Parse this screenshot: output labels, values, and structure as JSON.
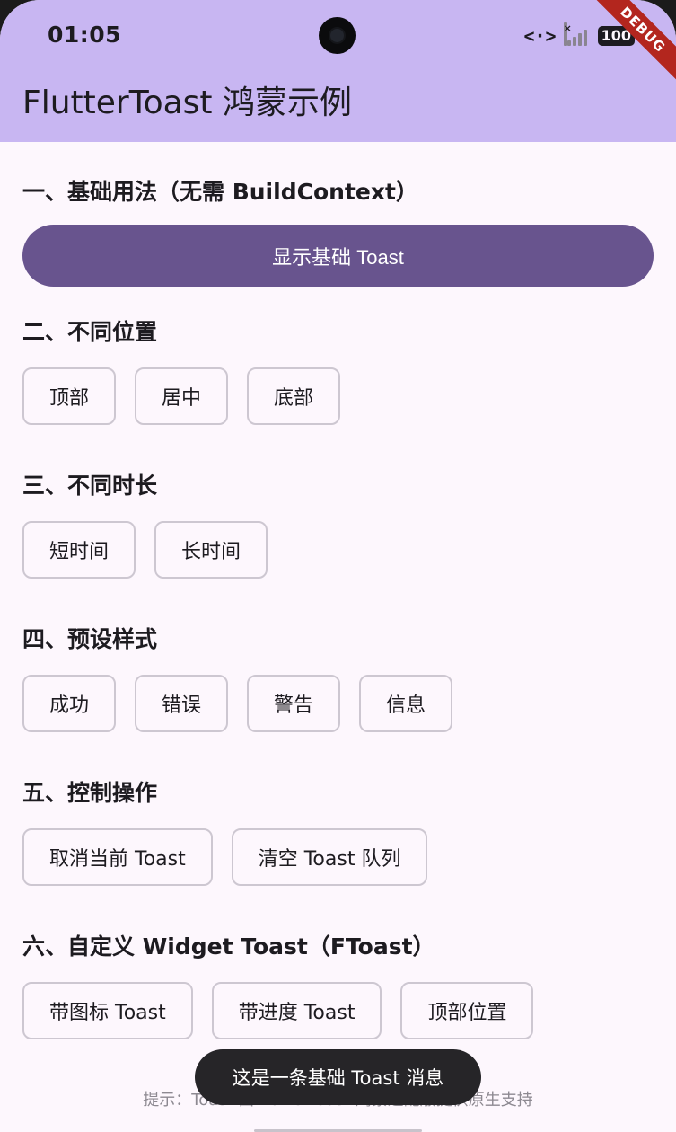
{
  "status_bar": {
    "time": "01:05",
    "code_icon": "<·>",
    "signal_x": "×",
    "battery": "100"
  },
  "debug_banner": "DEBUG",
  "app_title": "FlutterToast 鸿蒙示例",
  "sections": {
    "basic": {
      "title": "一、基础用法（无需 BuildContext）",
      "button": "显示基础 Toast"
    },
    "position": {
      "title": "二、不同位置",
      "buttons": [
        "顶部",
        "居中",
        "底部"
      ]
    },
    "duration": {
      "title": "三、不同时长",
      "buttons": [
        "短时间",
        "长时间"
      ]
    },
    "presets": {
      "title": "四、预设样式",
      "buttons": [
        "成功",
        "错误",
        "警告",
        "信息"
      ]
    },
    "control": {
      "title": "五、控制操作",
      "buttons": [
        "取消当前 Toast",
        "清空 Toast 队列"
      ]
    },
    "custom": {
      "title": "六、自定义 Widget Toast（FToast）",
      "buttons": [
        "带图标 Toast",
        "带进度 Toast",
        "顶部位置"
      ]
    }
  },
  "hint": "提示：Toast 由 fluttertoast 鸿蒙适配版提供原生支持",
  "toast_message": "这是一条基础 Toast 消息",
  "colors": {
    "app_bar": "#c8b6f2",
    "primary": "#68548e",
    "background": "#fdf7fd",
    "debug": "#b3261e"
  }
}
